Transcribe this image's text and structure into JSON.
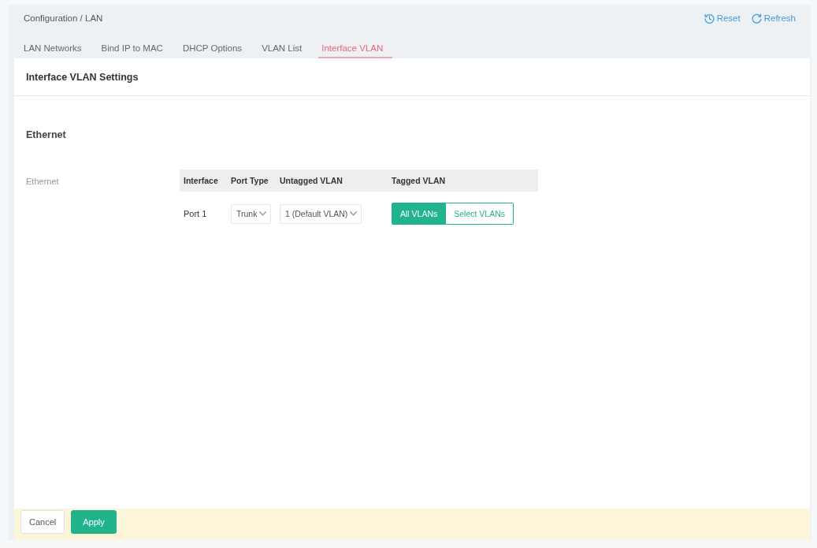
{
  "breadcrumb": "Configuration / LAN",
  "actions": [
    {
      "label": "Reset",
      "kind": "reset"
    },
    {
      "label": "Refresh",
      "kind": "refresh"
    }
  ],
  "tabs": [
    {
      "label": "LAN Networks",
      "selected": false
    },
    {
      "label": "Bind IP to MAC",
      "selected": false
    },
    {
      "label": "DHCP Options",
      "selected": false
    },
    {
      "label": "VLAN List",
      "selected": false
    },
    {
      "label": "Interface VLAN",
      "selected": true
    }
  ],
  "panel": {
    "title": "Interface VLAN Settings",
    "section": "Ethernet",
    "field_label": "Ethernet",
    "table": {
      "columns": [
        "Interface",
        "Port Type",
        "Untagged VLAN",
        "Tagged VLAN"
      ],
      "rows": [
        {
          "interface": "Port 1",
          "port_type": "Trunk",
          "untagged_vlan": "1 (Default VLAN)",
          "tagged_vlan": [
            {
              "label": "All VLANs",
              "selected": true
            },
            {
              "label": "Select VLANs",
              "selected": false
            }
          ]
        }
      ]
    }
  },
  "footer": {
    "buttons": [
      {
        "label": "Cancel",
        "kind": "secondary"
      },
      {
        "label": "Apply",
        "kind": "primary"
      }
    ]
  }
}
